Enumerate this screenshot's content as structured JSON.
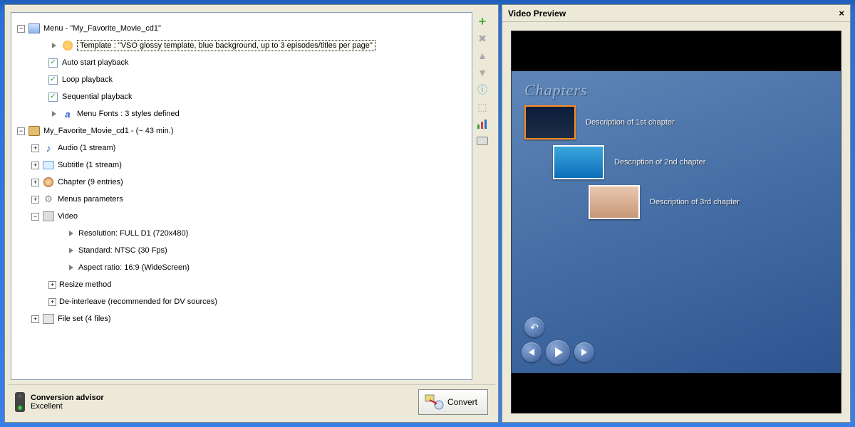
{
  "right": {
    "title": "Video Preview",
    "chapters_title": "Chapters",
    "chapters": [
      {
        "desc": "Description of 1st chapter"
      },
      {
        "desc": "Description of 2nd chapter"
      },
      {
        "desc": "Description of 3rd chapter"
      }
    ]
  },
  "advisor": {
    "title": "Conversion advisor",
    "status": "Excellent"
  },
  "convert_label": "Convert",
  "tree": {
    "menu_label": "Menu - \"My_Favorite_Movie_cd1\"",
    "template_label": "Template : \"VSO glossy template, blue background, up to 3 episodes/titles per page\"",
    "auto_start": "Auto start playback",
    "loop": "Loop playback",
    "sequential": "Sequential playback",
    "menu_fonts": "Menu Fonts : 3 styles defined",
    "movie_label": "My_Favorite_Movie_cd1 - (~ 43 min.)",
    "audio": "Audio (1 stream)",
    "subtitle": "Subtitle (1 stream)",
    "chapter": "Chapter (9 entries)",
    "menus_params": "Menus parameters",
    "video": "Video",
    "resolution": "Resolution: FULL D1 (720x480)",
    "standard": "Standard: NTSC (30 Fps)",
    "aspect": "Aspect ratio: 16:9 (WideScreen)",
    "resize": "Resize method",
    "deinterleave": "De-interleave (recommended for DV sources)",
    "fileset": "File set (4 files)"
  }
}
